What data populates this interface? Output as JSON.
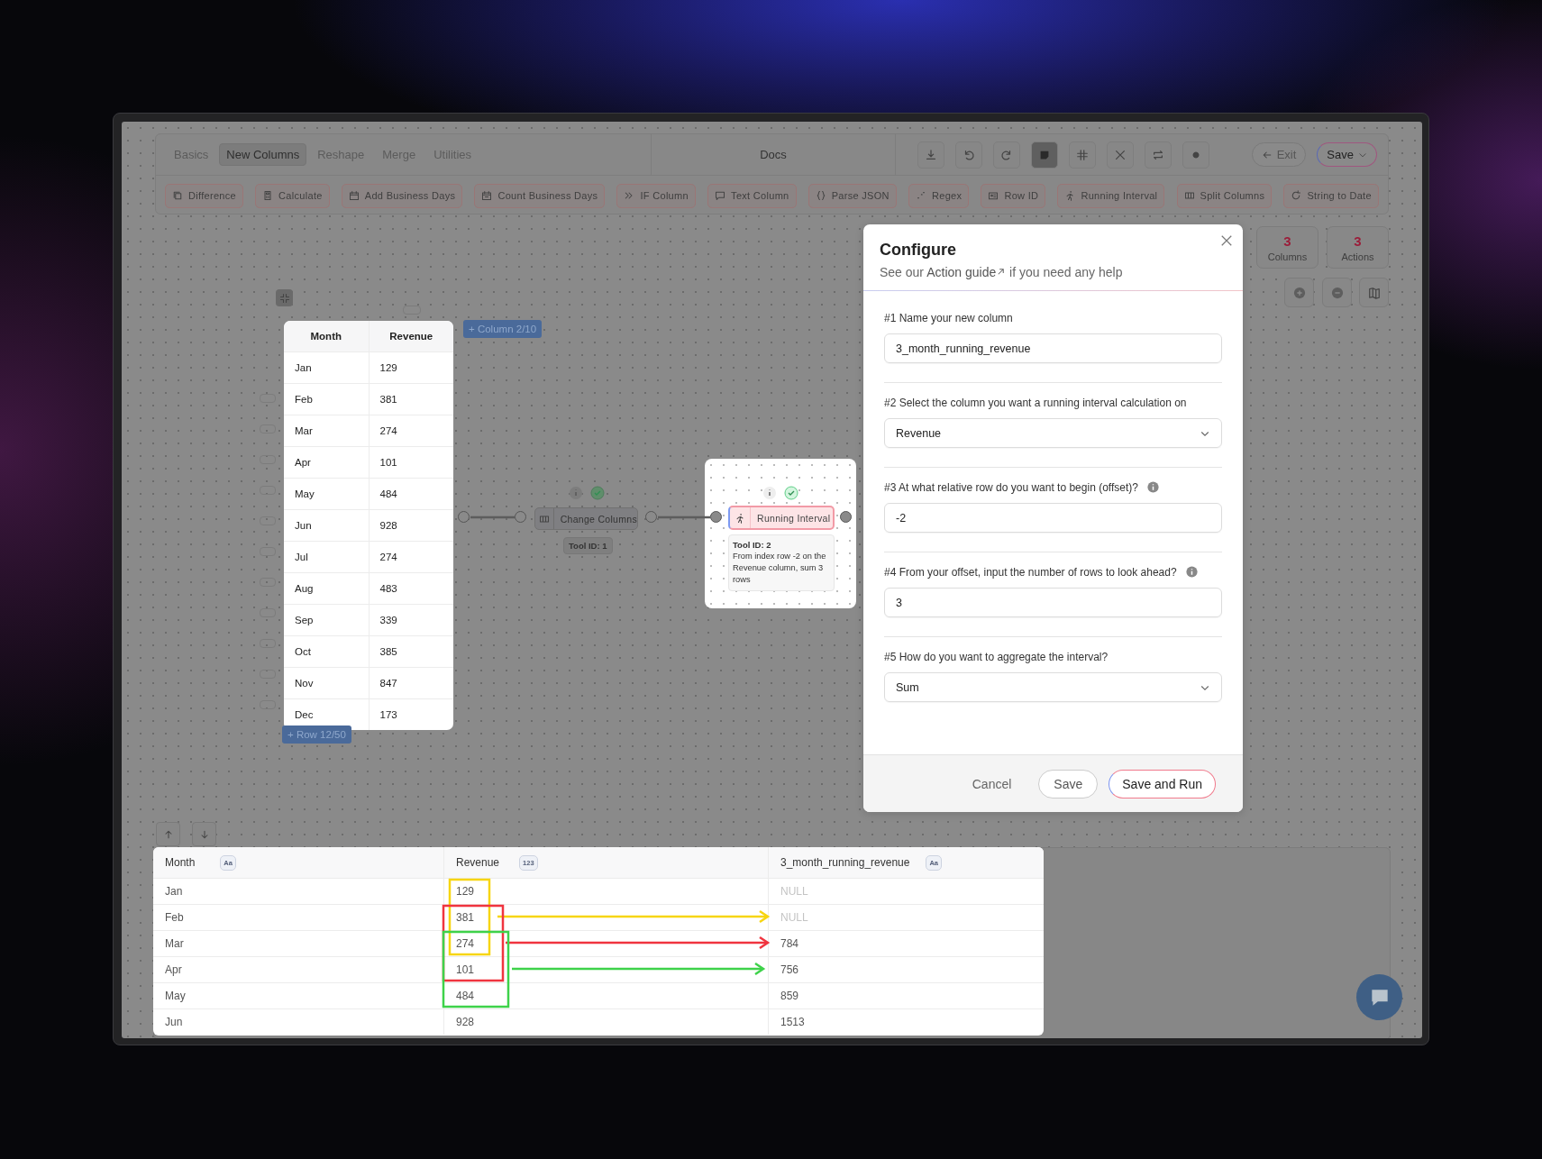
{
  "toolbar": {
    "tabs": [
      {
        "label": "Basics",
        "selected": false
      },
      {
        "label": "New Columns",
        "selected": true
      },
      {
        "label": "Reshape",
        "selected": false
      },
      {
        "label": "Merge",
        "selected": false
      },
      {
        "label": "Utilities",
        "selected": false
      }
    ],
    "docs": "Docs",
    "tools": [
      {
        "selected": false
      },
      {
        "selected": false
      },
      {
        "selected": false
      },
      {
        "selected": true
      },
      {
        "selected": false
      },
      {
        "selected": false
      },
      {
        "selected": false
      },
      {
        "selected": false
      }
    ],
    "exit": "Exit",
    "save": "Save"
  },
  "actions": [
    {
      "label": "Difference"
    },
    {
      "label": "Calculate"
    },
    {
      "label": "Add Business Days"
    },
    {
      "label": "Count Business Days"
    },
    {
      "label": "IF Column"
    },
    {
      "label": "Text Column"
    },
    {
      "label": "Parse JSON"
    },
    {
      "label": "Regex"
    },
    {
      "label": "Row ID"
    },
    {
      "label": "Running Interval"
    },
    {
      "label": "Split Columns"
    },
    {
      "label": "String to Date"
    }
  ],
  "stats": [
    {
      "value": "3",
      "label": "Columns"
    },
    {
      "value": "3",
      "label": "Actions"
    }
  ],
  "canvas": {
    "source_table": {
      "columns": [
        "Month",
        "Revenue"
      ],
      "rows": [
        [
          "Jan",
          "129"
        ],
        [
          "Feb",
          "381"
        ],
        [
          "Mar",
          "274"
        ],
        [
          "Apr",
          "101"
        ],
        [
          "May",
          "484"
        ],
        [
          "Jun",
          "928"
        ],
        [
          "Jul",
          "274"
        ],
        [
          "Aug",
          "483"
        ],
        [
          "Sep",
          "339"
        ],
        [
          "Oct",
          "385"
        ],
        [
          "Nov",
          "847"
        ],
        [
          "Dec",
          "173"
        ]
      ]
    },
    "add_column": "+ Column 2/10",
    "add_row": "+ Row 12/50",
    "nodes": [
      {
        "label": "Change Columns",
        "tool_id": "Tool ID: 1",
        "highlighted": false
      },
      {
        "label": "Running Interval",
        "tool_id": "Tool ID: 2",
        "description": "From index row -2 on the Revenue column, sum 3 rows",
        "highlighted": true
      }
    ]
  },
  "configure": {
    "title": "Configure",
    "subtitle": {
      "before": "See our ",
      "link": "Action guide",
      "after": " if you need any help"
    },
    "fields": [
      {
        "kind": "text",
        "label": "#1 Name your new column",
        "value": "3_month_running_revenue",
        "info": false
      },
      {
        "kind": "select",
        "label": "#2 Select the column you want a running interval calculation on",
        "value": "Revenue",
        "info": false
      },
      {
        "kind": "text",
        "label": "#3 At what relative row do you want to begin (offset)?",
        "value": "-2",
        "info": true
      },
      {
        "kind": "text",
        "label": "#4 From your offset, input the number of rows to look ahead?",
        "value": "3",
        "info": true
      },
      {
        "kind": "select",
        "label": "#5 How do you want to aggregate the interval?",
        "value": "Sum",
        "info": false
      }
    ],
    "buttons": [
      {
        "label": "Cancel",
        "kind": "plain"
      },
      {
        "label": "Save",
        "kind": "outline"
      },
      {
        "label": "Save and Run",
        "kind": "primary"
      }
    ]
  },
  "result_table": {
    "columns": [
      {
        "name": "Month",
        "type": "Aa"
      },
      {
        "name": "Revenue",
        "type": "123"
      },
      {
        "name": "3_month_running_revenue",
        "type": "Aa"
      }
    ],
    "rows": [
      {
        "cells": [
          "Jan",
          "129",
          "NULL"
        ],
        "null_result": true
      },
      {
        "cells": [
          "Feb",
          "381",
          "NULL"
        ],
        "null_result": true
      },
      {
        "cells": [
          "Mar",
          "274",
          "784"
        ],
        "null_result": false
      },
      {
        "cells": [
          "Apr",
          "101",
          "756"
        ],
        "null_result": false
      },
      {
        "cells": [
          "May",
          "484",
          "859"
        ],
        "null_result": false
      },
      {
        "cells": [
          "Jun",
          "928",
          "1513"
        ],
        "null_result": false
      }
    ]
  },
  "highlights": [
    {
      "color": "#f7d511"
    },
    {
      "color": "#f0343f"
    },
    {
      "color": "#3ed24a"
    }
  ]
}
